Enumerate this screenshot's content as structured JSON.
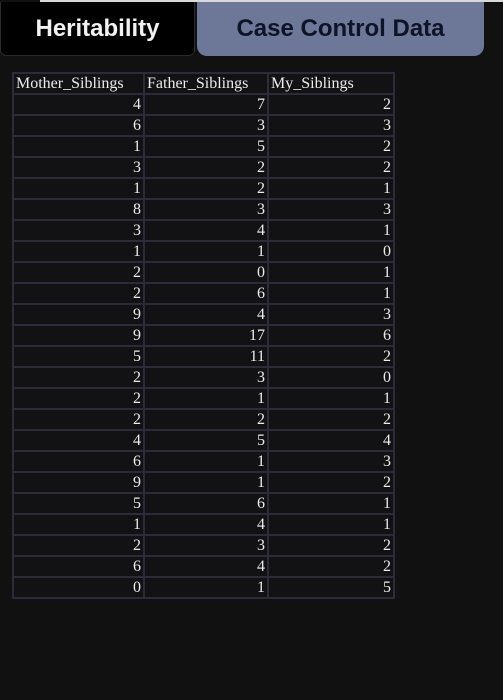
{
  "tabs": [
    {
      "label": "Heritability",
      "active": true
    },
    {
      "label": "Case Control Data",
      "active": false
    }
  ],
  "table": {
    "headers": [
      "Mother_Siblings",
      "Father_Siblings",
      "My_Siblings"
    ],
    "rows": [
      [
        4,
        7,
        2
      ],
      [
        6,
        3,
        3
      ],
      [
        1,
        5,
        2
      ],
      [
        3,
        2,
        2
      ],
      [
        1,
        2,
        1
      ],
      [
        8,
        3,
        3
      ],
      [
        3,
        4,
        1
      ],
      [
        1,
        1,
        0
      ],
      [
        2,
        0,
        1
      ],
      [
        2,
        6,
        1
      ],
      [
        9,
        4,
        3
      ],
      [
        9,
        17,
        6
      ],
      [
        5,
        11,
        2
      ],
      [
        2,
        3,
        0
      ],
      [
        2,
        1,
        1
      ],
      [
        2,
        2,
        2
      ],
      [
        4,
        5,
        4
      ],
      [
        6,
        1,
        3
      ],
      [
        9,
        1,
        2
      ],
      [
        5,
        6,
        1
      ],
      [
        1,
        4,
        1
      ],
      [
        2,
        3,
        2
      ],
      [
        6,
        4,
        2
      ],
      [
        0,
        1,
        5
      ]
    ]
  },
  "colors": {
    "background": "#111112",
    "active_tab": "#000000",
    "inactive_tab": "#6d7797",
    "grid_line": "#2c2b3a",
    "text": "#ececec"
  }
}
